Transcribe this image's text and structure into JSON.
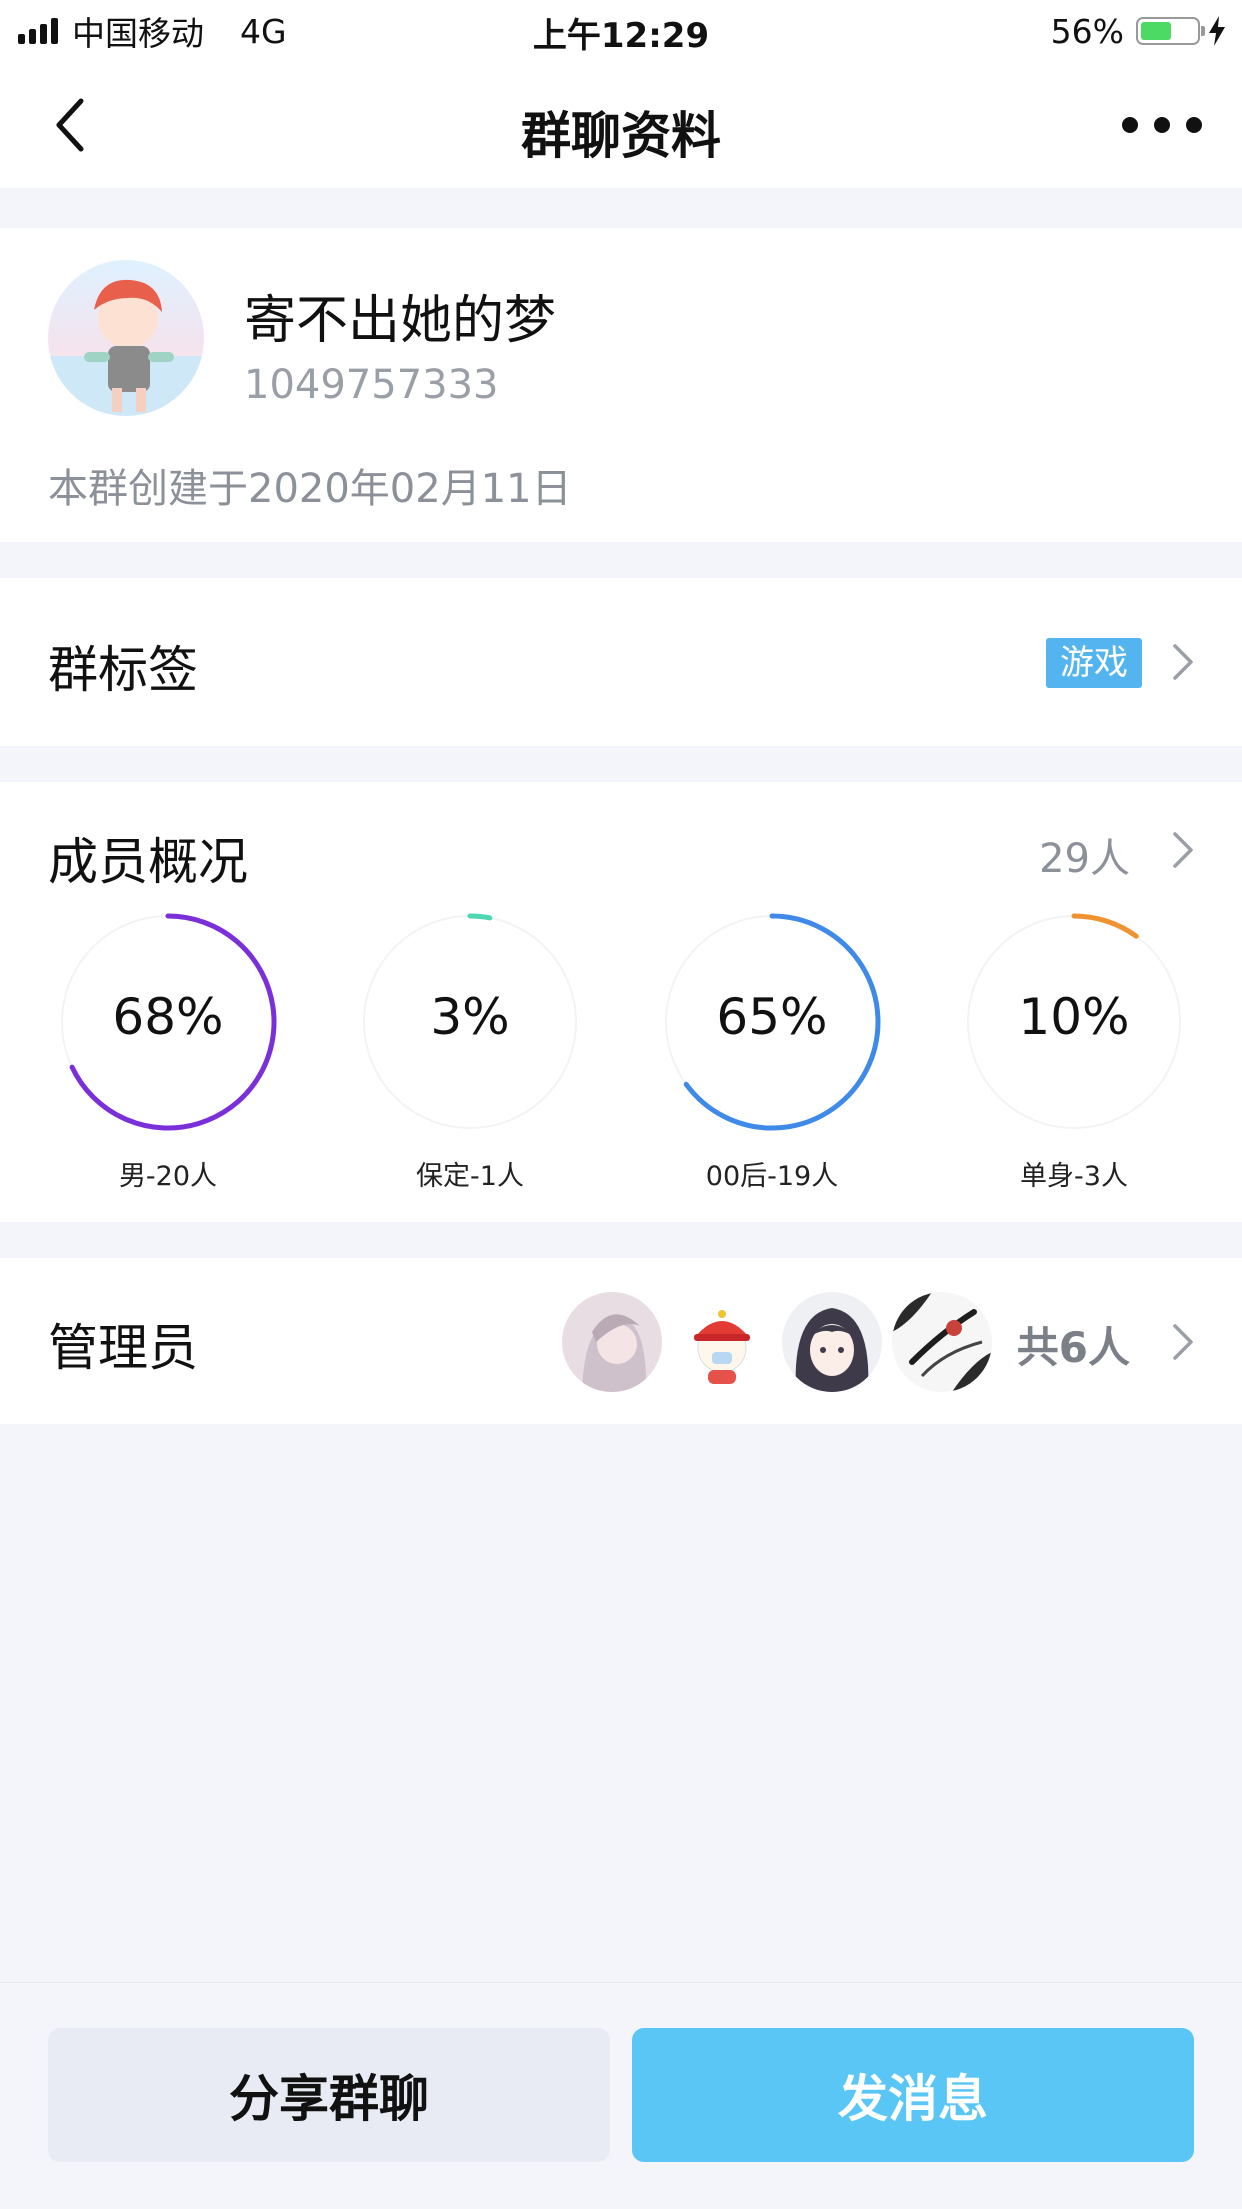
{
  "status_bar": {
    "carrier": "中国移动",
    "network": "4G",
    "time": "上午12:29",
    "battery_percent": "56%",
    "battery_level": 0.56
  },
  "nav": {
    "title": "群聊资料"
  },
  "group": {
    "name": "寄不出她的梦",
    "id": "1049757333",
    "created": "本群创建于2020年02月11日"
  },
  "tag_row": {
    "label": "群标签",
    "tag": "游戏",
    "tag_color": "#53b4ef"
  },
  "members": {
    "label": "成员概况",
    "count": "29人",
    "stats": [
      {
        "percent_text": "68%",
        "value": 0.68,
        "label": "男-20人",
        "color": "#7a2fd9"
      },
      {
        "percent_text": "3%",
        "value": 0.03,
        "label": "保定-1人",
        "color": "#4fd6b2"
      },
      {
        "percent_text": "65%",
        "value": 0.65,
        "label": "00后-19人",
        "color": "#3f8ae8"
      },
      {
        "percent_text": "10%",
        "value": 0.1,
        "label": "单身-3人",
        "color": "#f0922f"
      }
    ]
  },
  "admins": {
    "label": "管理员",
    "count": "共6人"
  },
  "actions": {
    "share_label": "分享群聊",
    "send_label": "发消息",
    "send_color": "#5ac6f6"
  }
}
